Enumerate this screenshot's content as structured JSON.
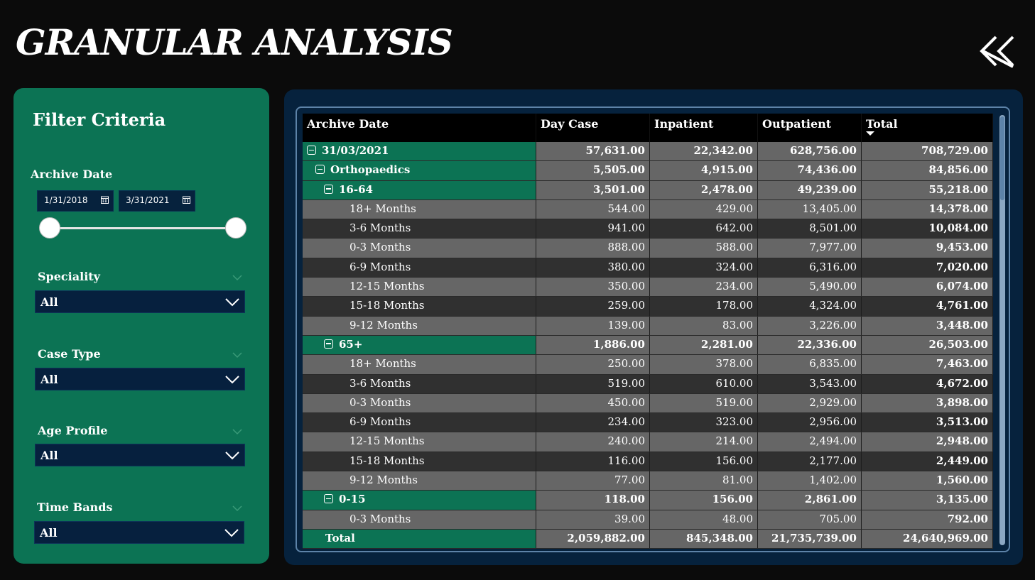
{
  "page": {
    "title": "GRANULAR ANALYSIS"
  },
  "filters": {
    "title": "Filter Criteria",
    "archive_date": {
      "label": "Archive Date",
      "start": "1/31/2018",
      "end": "3/31/2021"
    },
    "speciality": {
      "label": "Speciality",
      "value": "All"
    },
    "case_type": {
      "label": "Case Type",
      "value": "All"
    },
    "age_profile": {
      "label": "Age Profile",
      "value": "All"
    },
    "time_bands": {
      "label": "Time Bands",
      "value": "All"
    }
  },
  "table": {
    "columns": [
      "Archive Date",
      "Day Case",
      "Inpatient",
      "Outpatient",
      "Total"
    ],
    "sorted_column": "Total",
    "rows": [
      {
        "level": 0,
        "label": "31/03/2021",
        "values": [
          "57,631.00",
          "22,342.00",
          "628,756.00",
          "708,729.00"
        ]
      },
      {
        "level": 1,
        "label": "Orthopaedics",
        "values": [
          "5,505.00",
          "4,915.00",
          "74,436.00",
          "84,856.00"
        ]
      },
      {
        "level": 2,
        "label": "16-64",
        "values": [
          "3,501.00",
          "2,478.00",
          "49,239.00",
          "55,218.00"
        ]
      },
      {
        "level": 3,
        "label": "18+ Months",
        "values": [
          "544.00",
          "429.00",
          "13,405.00",
          "14,378.00"
        ]
      },
      {
        "level": 3,
        "label": "3-6 Months",
        "values": [
          "941.00",
          "642.00",
          "8,501.00",
          "10,084.00"
        ]
      },
      {
        "level": 3,
        "label": "0-3 Months",
        "values": [
          "888.00",
          "588.00",
          "7,977.00",
          "9,453.00"
        ]
      },
      {
        "level": 3,
        "label": "6-9 Months",
        "values": [
          "380.00",
          "324.00",
          "6,316.00",
          "7,020.00"
        ]
      },
      {
        "level": 3,
        "label": "12-15 Months",
        "values": [
          "350.00",
          "234.00",
          "5,490.00",
          "6,074.00"
        ]
      },
      {
        "level": 3,
        "label": "15-18 Months",
        "values": [
          "259.00",
          "178.00",
          "4,324.00",
          "4,761.00"
        ]
      },
      {
        "level": 3,
        "label": "9-12 Months",
        "values": [
          "139.00",
          "83.00",
          "3,226.00",
          "3,448.00"
        ]
      },
      {
        "level": 2,
        "label": "65+",
        "values": [
          "1,886.00",
          "2,281.00",
          "22,336.00",
          "26,503.00"
        ]
      },
      {
        "level": 3,
        "label": "18+ Months",
        "values": [
          "250.00",
          "378.00",
          "6,835.00",
          "7,463.00"
        ]
      },
      {
        "level": 3,
        "label": "3-6 Months",
        "values": [
          "519.00",
          "610.00",
          "3,543.00",
          "4,672.00"
        ]
      },
      {
        "level": 3,
        "label": "0-3 Months",
        "values": [
          "450.00",
          "519.00",
          "2,929.00",
          "3,898.00"
        ]
      },
      {
        "level": 3,
        "label": "6-9 Months",
        "values": [
          "234.00",
          "323.00",
          "2,956.00",
          "3,513.00"
        ]
      },
      {
        "level": 3,
        "label": "12-15 Months",
        "values": [
          "240.00",
          "214.00",
          "2,494.00",
          "2,948.00"
        ]
      },
      {
        "level": 3,
        "label": "15-18 Months",
        "values": [
          "116.00",
          "156.00",
          "2,177.00",
          "2,449.00"
        ]
      },
      {
        "level": 3,
        "label": "9-12 Months",
        "values": [
          "77.00",
          "81.00",
          "1,402.00",
          "1,560.00"
        ]
      },
      {
        "level": 2,
        "label": "0-15",
        "values": [
          "118.00",
          "156.00",
          "2,861.00",
          "3,135.00"
        ]
      },
      {
        "level": 3,
        "label": "0-3 Months",
        "values": [
          "39.00",
          "48.00",
          "705.00",
          "792.00"
        ]
      }
    ],
    "total": {
      "label": "Total",
      "values": [
        "2,059,882.00",
        "845,348.00",
        "21,735,739.00",
        "24,640,969.00"
      ]
    }
  },
  "icons": {
    "back": "double-chevron-left-icon",
    "collapse": "minus-box-icon",
    "calendar": "calendar-icon",
    "dropdown": "chevron-down-icon"
  },
  "colors": {
    "background": "#0b0b0b",
    "panel_green": "#0c7354",
    "panel_navy": "#06223d",
    "cell_grey": "#666666",
    "cell_dark": "#303030"
  }
}
